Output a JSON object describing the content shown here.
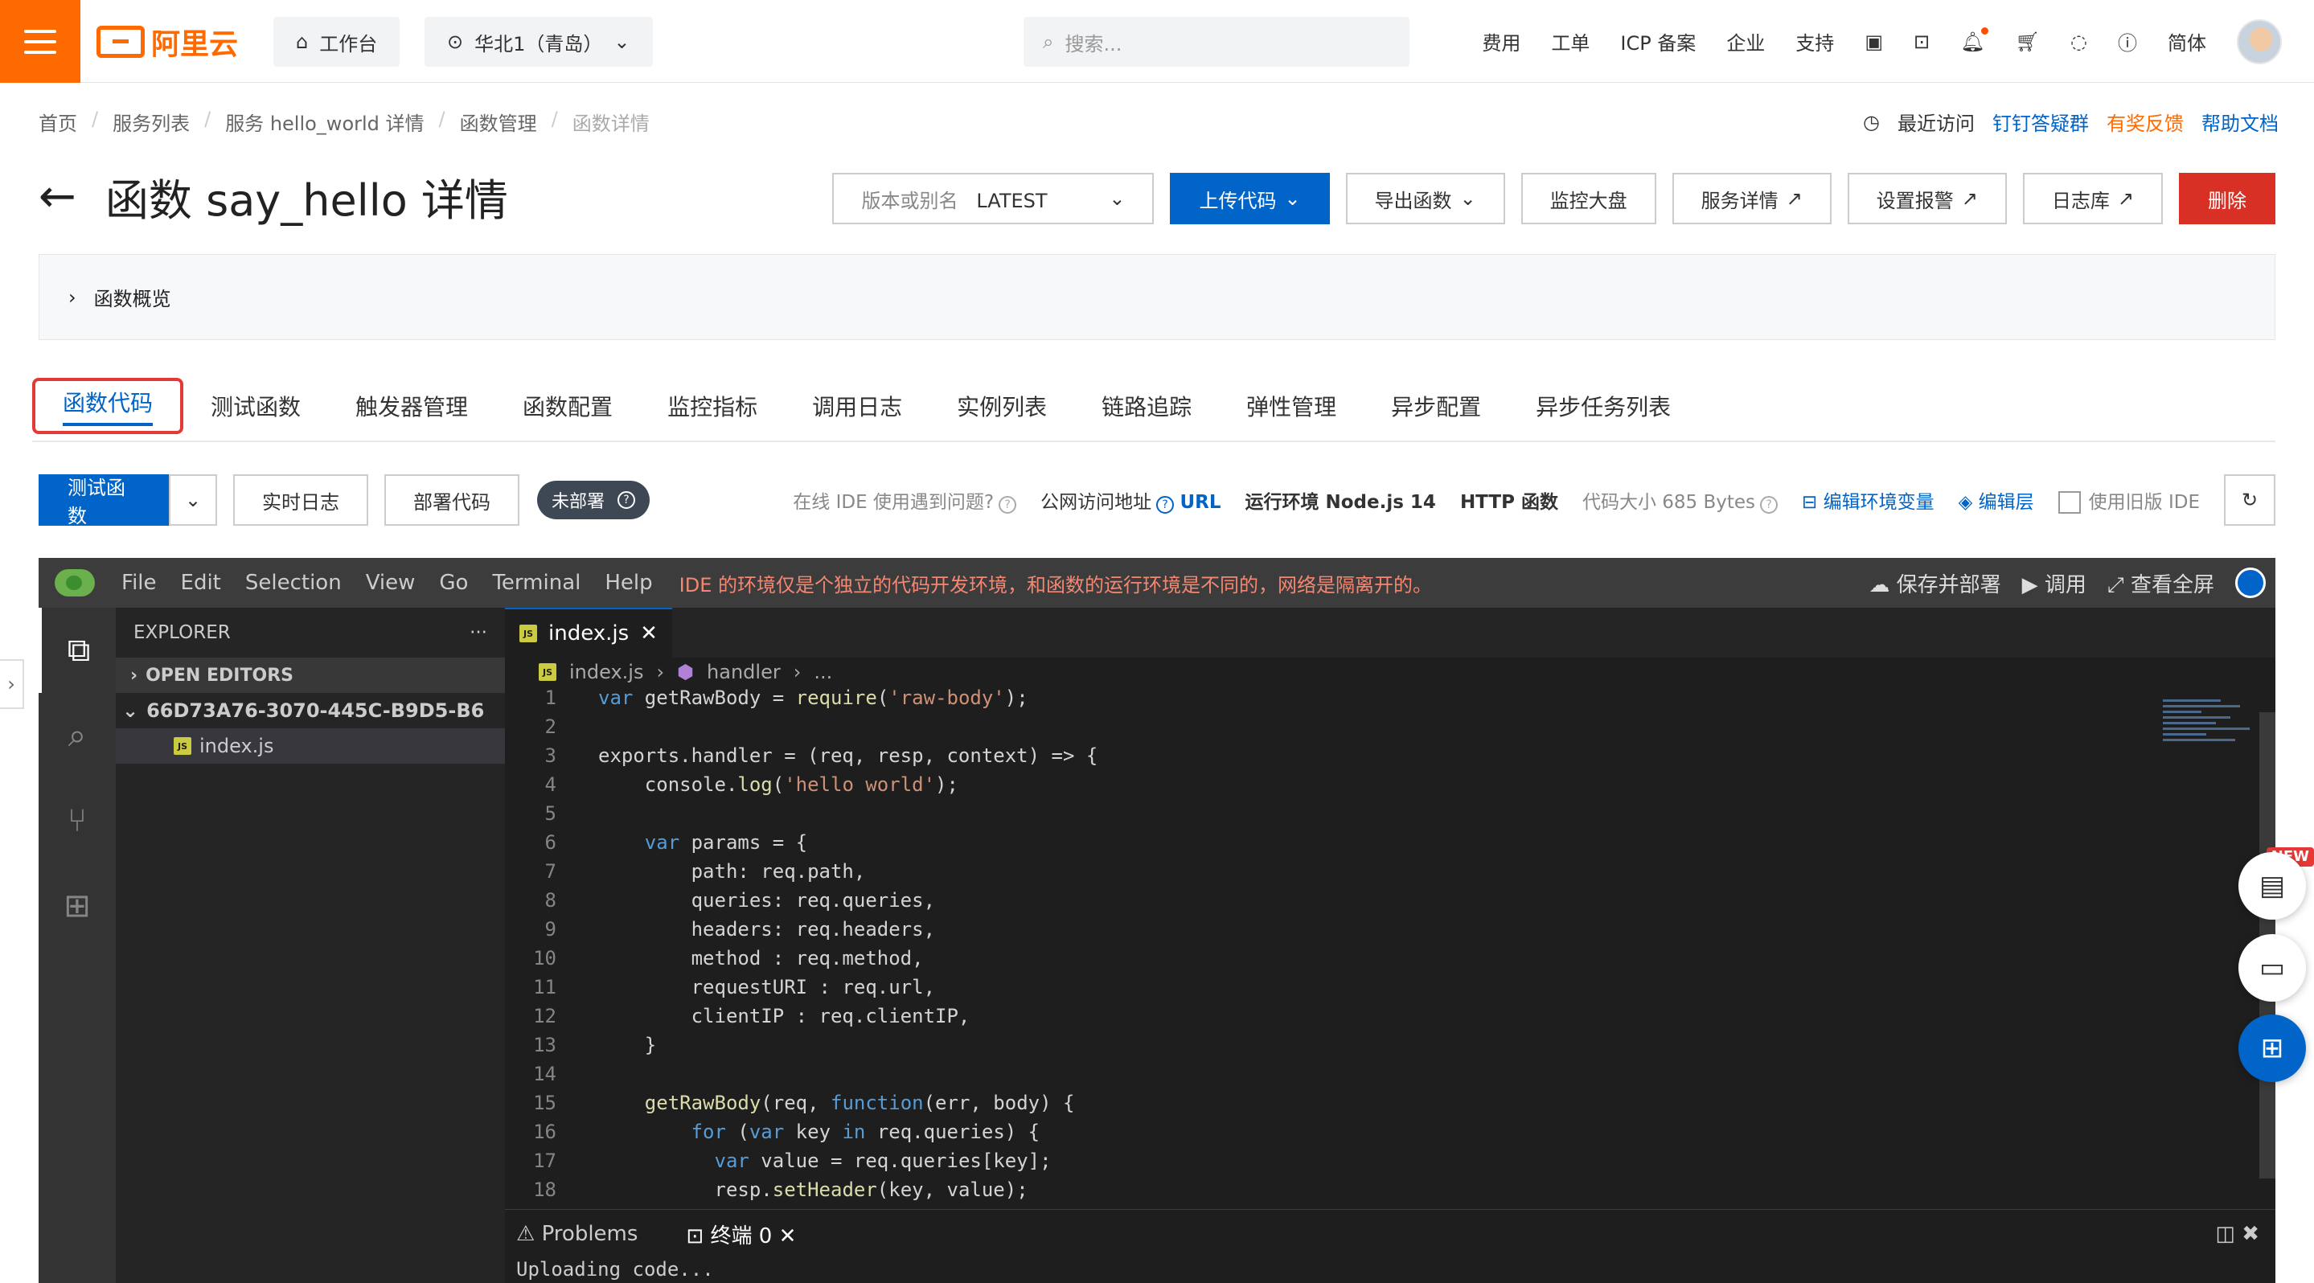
{
  "brand": {
    "name": "阿里云",
    "accent": "#ff6a00",
    "primary": "#0064c8",
    "danger": "#d93026"
  },
  "topbar": {
    "workbench": "工作台",
    "region": "华北1（青岛）",
    "search_placeholder": "搜索...",
    "links": [
      "费用",
      "工单",
      "ICP 备案",
      "企业",
      "支持"
    ],
    "language": "简体"
  },
  "breadcrumb": [
    "首页",
    "服务列表",
    "服务 hello_world 详情",
    "函数管理",
    "函数详情"
  ],
  "quick_links": {
    "recent": "最近访问",
    "dingtalk": "钉钉答疑群",
    "feedback": "有奖反馈",
    "help": "帮助文档"
  },
  "page": {
    "title": "函数 say_hello 详情"
  },
  "header_buttons": {
    "version_label": "版本或别名",
    "version_value": "LATEST",
    "upload": "上传代码",
    "export": "导出函数",
    "monitor": "监控大盘",
    "service": "服务详情",
    "alarm": "设置报警",
    "logs": "日志库",
    "delete": "删除"
  },
  "overview": {
    "label": "函数概览"
  },
  "tabs": [
    "函数代码",
    "测试函数",
    "触发器管理",
    "函数配置",
    "监控指标",
    "调用日志",
    "实例列表",
    "链路追踪",
    "弹性管理",
    "异步配置",
    "异步任务列表"
  ],
  "toolbar": {
    "test": "测试函数",
    "realtime_log": "实时日志",
    "deploy": "部署代码",
    "status": "未部署",
    "ide_issue": "在线 IDE 使用遇到问题?",
    "public_url_label": "公网访问地址",
    "url": "URL",
    "runtime": "运行环境 Node.js 14",
    "http": "HTTP 函数",
    "code_size": "代码大小 685 Bytes",
    "env": "编辑环境变量",
    "layer": "编辑层",
    "old_ide": "使用旧版 IDE"
  },
  "ide": {
    "menu": [
      "File",
      "Edit",
      "Selection",
      "View",
      "Go",
      "Terminal",
      "Help"
    ],
    "warning": "IDE 的环境仅是个独立的代码开发环境，和函数的运行环境是不同的，网络是隔离开的。",
    "actions": {
      "save_deploy": "保存并部署",
      "invoke": "调用",
      "fullscreen": "查看全屏"
    },
    "explorer": {
      "title": "EXPLORER",
      "open_editors": "OPEN EDITORS",
      "folder": "66D73A76-3070-445C-B9D5-B6",
      "file": "index.js"
    },
    "tab": "index.js",
    "crumbs": [
      "index.js",
      "handler",
      "..."
    ],
    "code_lines": [
      {
        "n": "1",
        "text": "var getRawBody = require('raw-body');"
      },
      {
        "n": "2",
        "text": ""
      },
      {
        "n": "3",
        "text": "exports.handler = (req, resp, context) => {"
      },
      {
        "n": "4",
        "text": "    console.log('hello world');"
      },
      {
        "n": "5",
        "text": ""
      },
      {
        "n": "6",
        "text": "    var params = {"
      },
      {
        "n": "7",
        "text": "        path: req.path,"
      },
      {
        "n": "8",
        "text": "        queries: req.queries,"
      },
      {
        "n": "9",
        "text": "        headers: req.headers,"
      },
      {
        "n": "10",
        "text": "        method : req.method,"
      },
      {
        "n": "11",
        "text": "        requestURI : req.url,"
      },
      {
        "n": "12",
        "text": "        clientIP : req.clientIP,"
      },
      {
        "n": "13",
        "text": "    }"
      },
      {
        "n": "14",
        "text": ""
      },
      {
        "n": "15",
        "text": "    getRawBody(req, function(err, body) {"
      },
      {
        "n": "16",
        "text": "        for (var key in req.queries) {"
      },
      {
        "n": "17",
        "text": "          var value = req.queries[key];"
      },
      {
        "n": "18",
        "text": "          resp.setHeader(key, value);"
      }
    ],
    "panel": {
      "problems": "Problems",
      "terminal": "终端 0",
      "output": "Uploading code..."
    }
  },
  "float": {
    "new_badge": "NEW"
  }
}
